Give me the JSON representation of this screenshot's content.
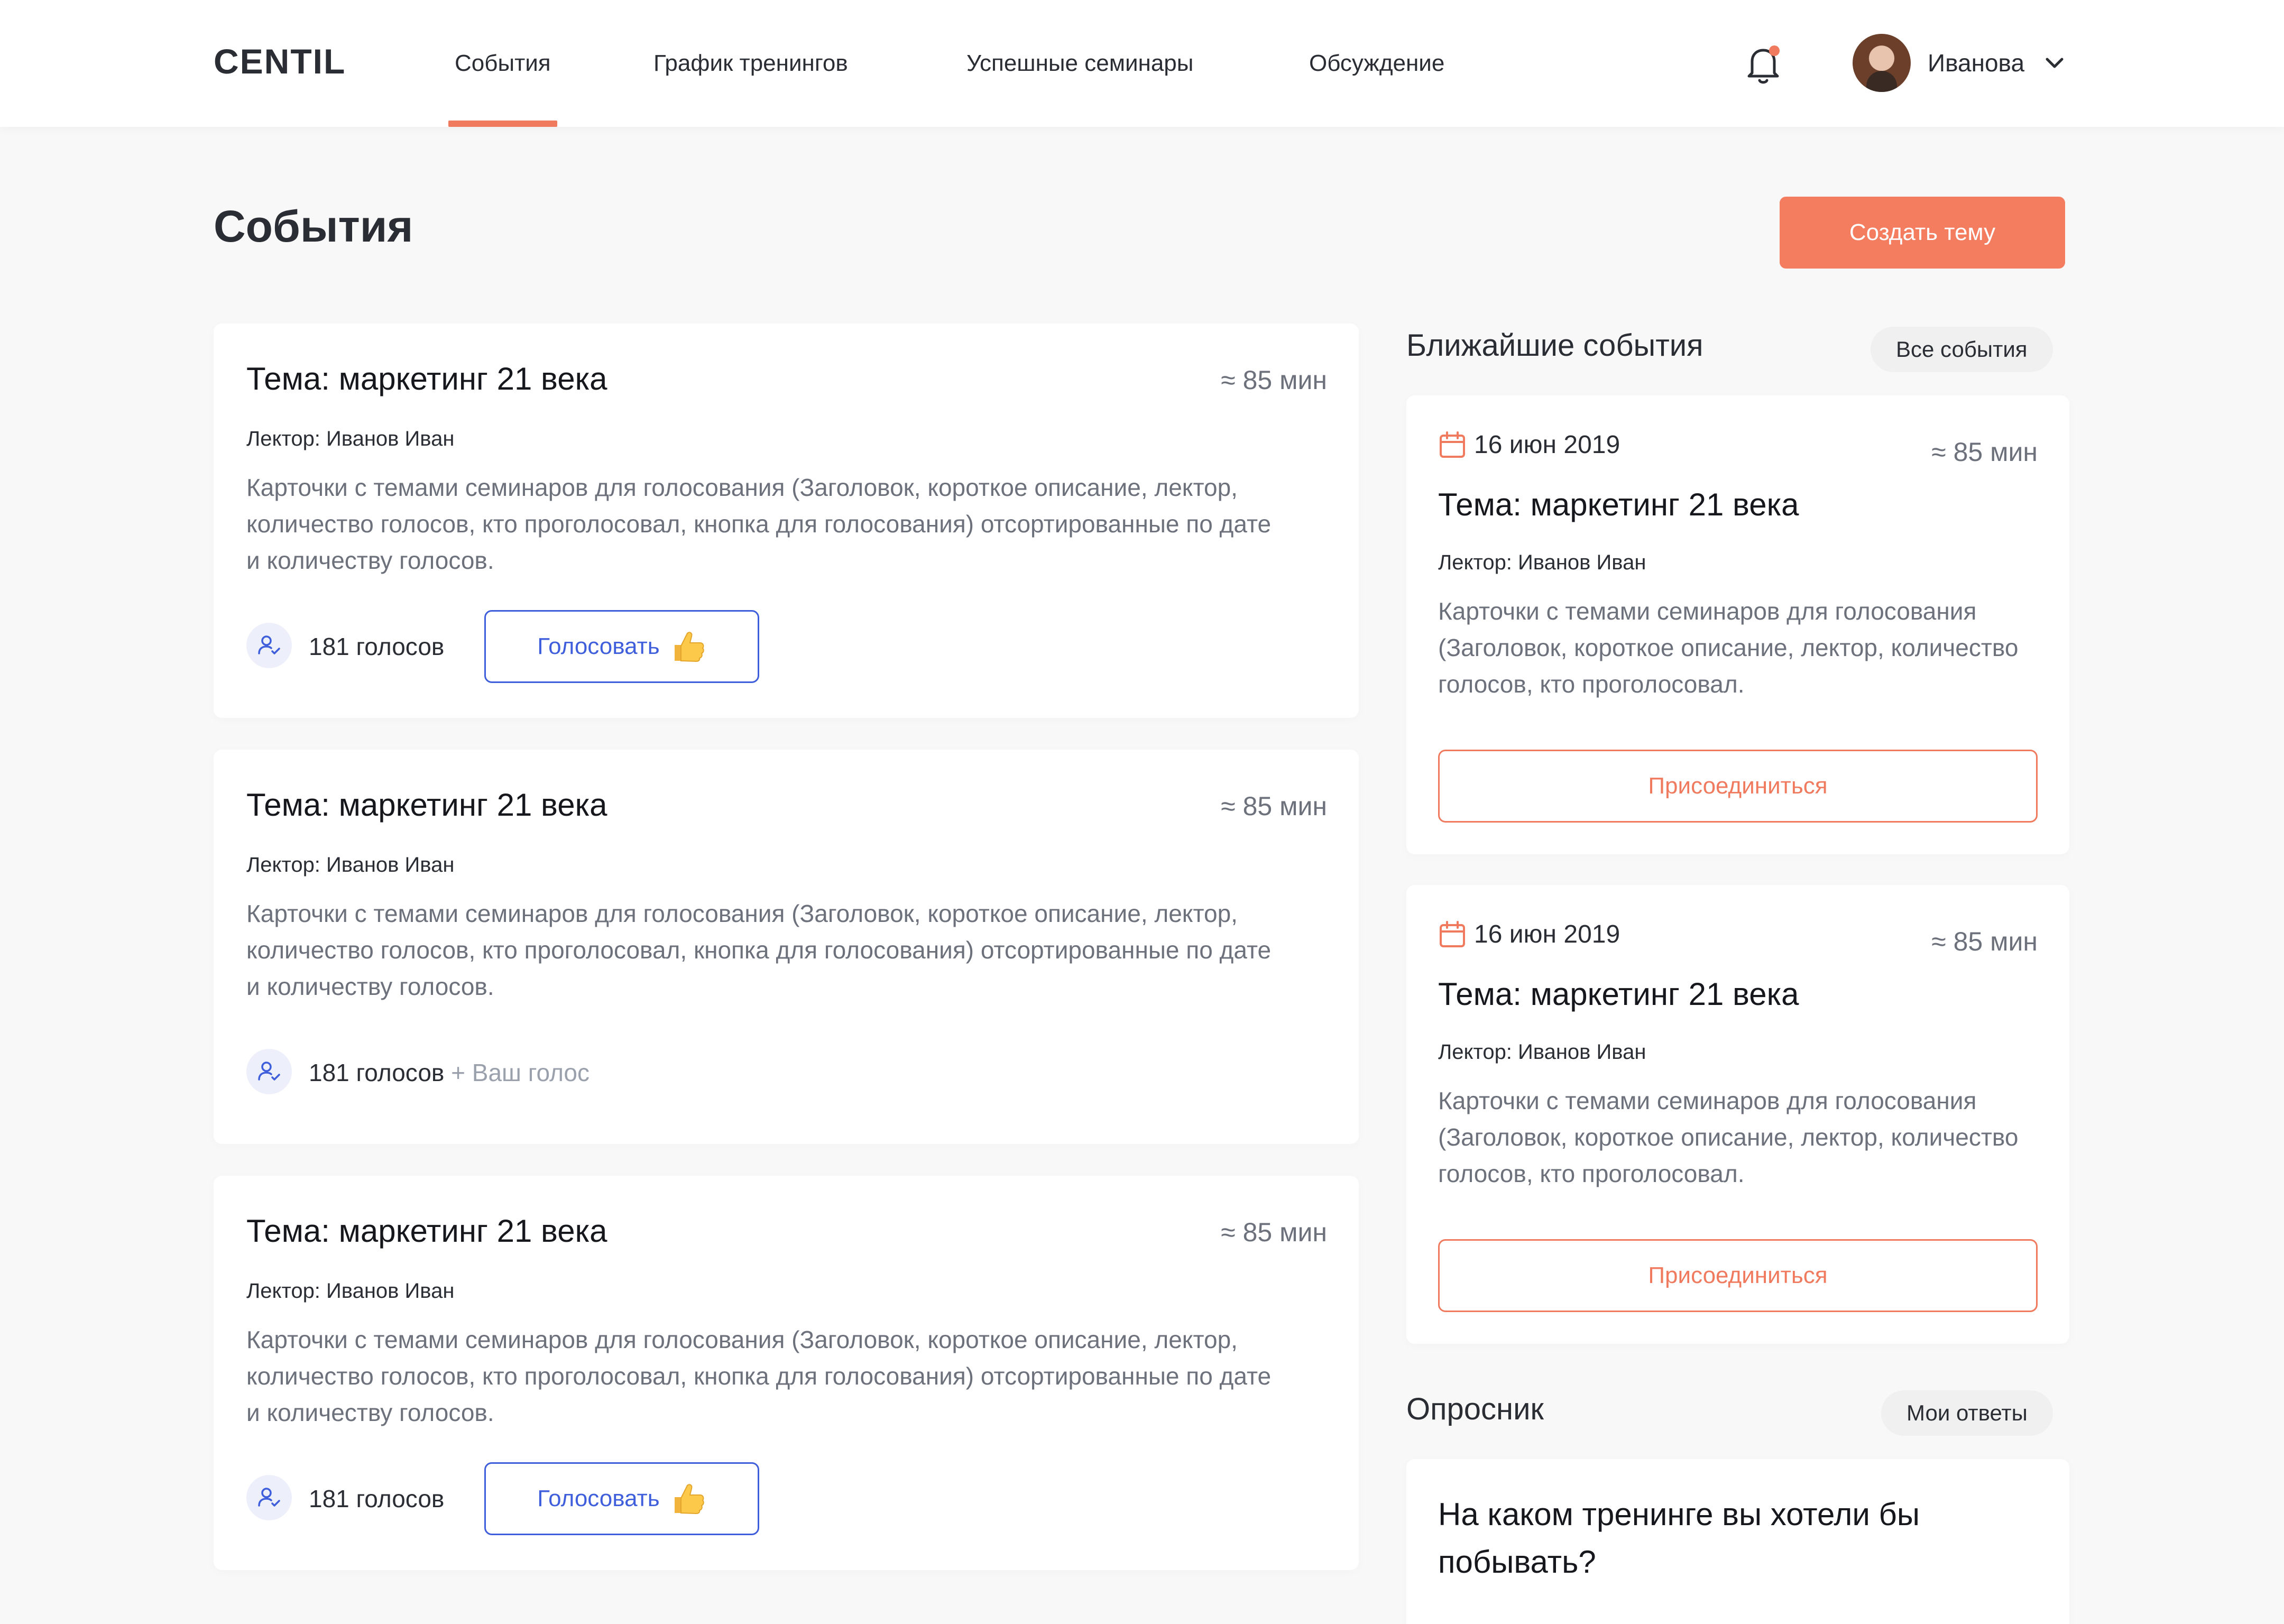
{
  "header": {
    "logo": "CENTIL",
    "nav": [
      {
        "label": "События",
        "active": true
      },
      {
        "label": "График тренингов",
        "active": false
      },
      {
        "label": "Успешные семинары",
        "active": false
      },
      {
        "label": "Обсуждение",
        "active": false
      }
    ],
    "notification_icon": "bell-icon",
    "notification_dot_color": "#F07A5E",
    "user": {
      "name": "Иванова",
      "menu_icon": "chevron-down-icon"
    }
  },
  "page": {
    "title": "События",
    "create_button": "Создать тему"
  },
  "events": [
    {
      "title": "Тема: маркетинг 21 века",
      "duration": "≈ 85 мин",
      "lector": "Лектор: Иванов Иван",
      "description": "Карточки с темами семинаров для голосования (Заголовок, короткое описание, лектор, количество голосов, кто проголосовал, кнопка для голосования) отсортированные по дате и количеству голосов.",
      "votes": "181 голосов",
      "your_vote": "",
      "vote_button": "Голосовать"
    },
    {
      "title": "Тема: маркетинг 21 века",
      "duration": "≈ 85 мин",
      "lector": "Лектор: Иванов Иван",
      "description": "Карточки с темами семинаров для голосования (Заголовок, короткое описание, лектор, количество голосов, кто проголосовал, кнопка для голосования) отсортированные по дате и количеству голосов.",
      "votes": "181 голосов",
      "your_vote": " + Ваш голос",
      "vote_button": ""
    },
    {
      "title": "Тема: маркетинг 21 века",
      "duration": "≈ 85 мин",
      "lector": "Лектор: Иванов Иван",
      "description": "Карточки с темами семинаров для голосования (Заголовок, короткое описание, лектор, количество голосов, кто проголосовал, кнопка для голосования) отсортированные по дате и количеству голосов.",
      "votes": "181 голосов",
      "your_vote": "",
      "vote_button": "Голосовать"
    }
  ],
  "upcoming": {
    "heading": "Ближайшие события",
    "all_button": "Все события",
    "items": [
      {
        "date": "16 июн 2019",
        "duration": "≈ 85 мин",
        "title": "Тема: маркетинг 21 века",
        "lector": "Лектор: Иванов Иван",
        "description": "Карточки с темами семинаров для голосования (Заголовок, короткое описание, лектор, количество голосов, кто проголосовал.",
        "join_button": "Присоединиться"
      },
      {
        "date": "16 июн 2019",
        "duration": "≈ 85 мин",
        "title": "Тема: маркетинг 21 века",
        "lector": "Лектор: Иванов Иван",
        "description": "Карточки с темами семинаров для голосования (Заголовок, короткое описание, лектор, количество голосов, кто проголосовал.",
        "join_button": "Присоединиться"
      }
    ]
  },
  "poll": {
    "heading": "Опросник",
    "answers_button": "Мои ответы",
    "question": "На каком тренинге вы хотели бы побывать?"
  },
  "colors": {
    "accent": "#F47C5F",
    "link_blue": "#3F5EDB",
    "background": "#F8F8F8"
  }
}
